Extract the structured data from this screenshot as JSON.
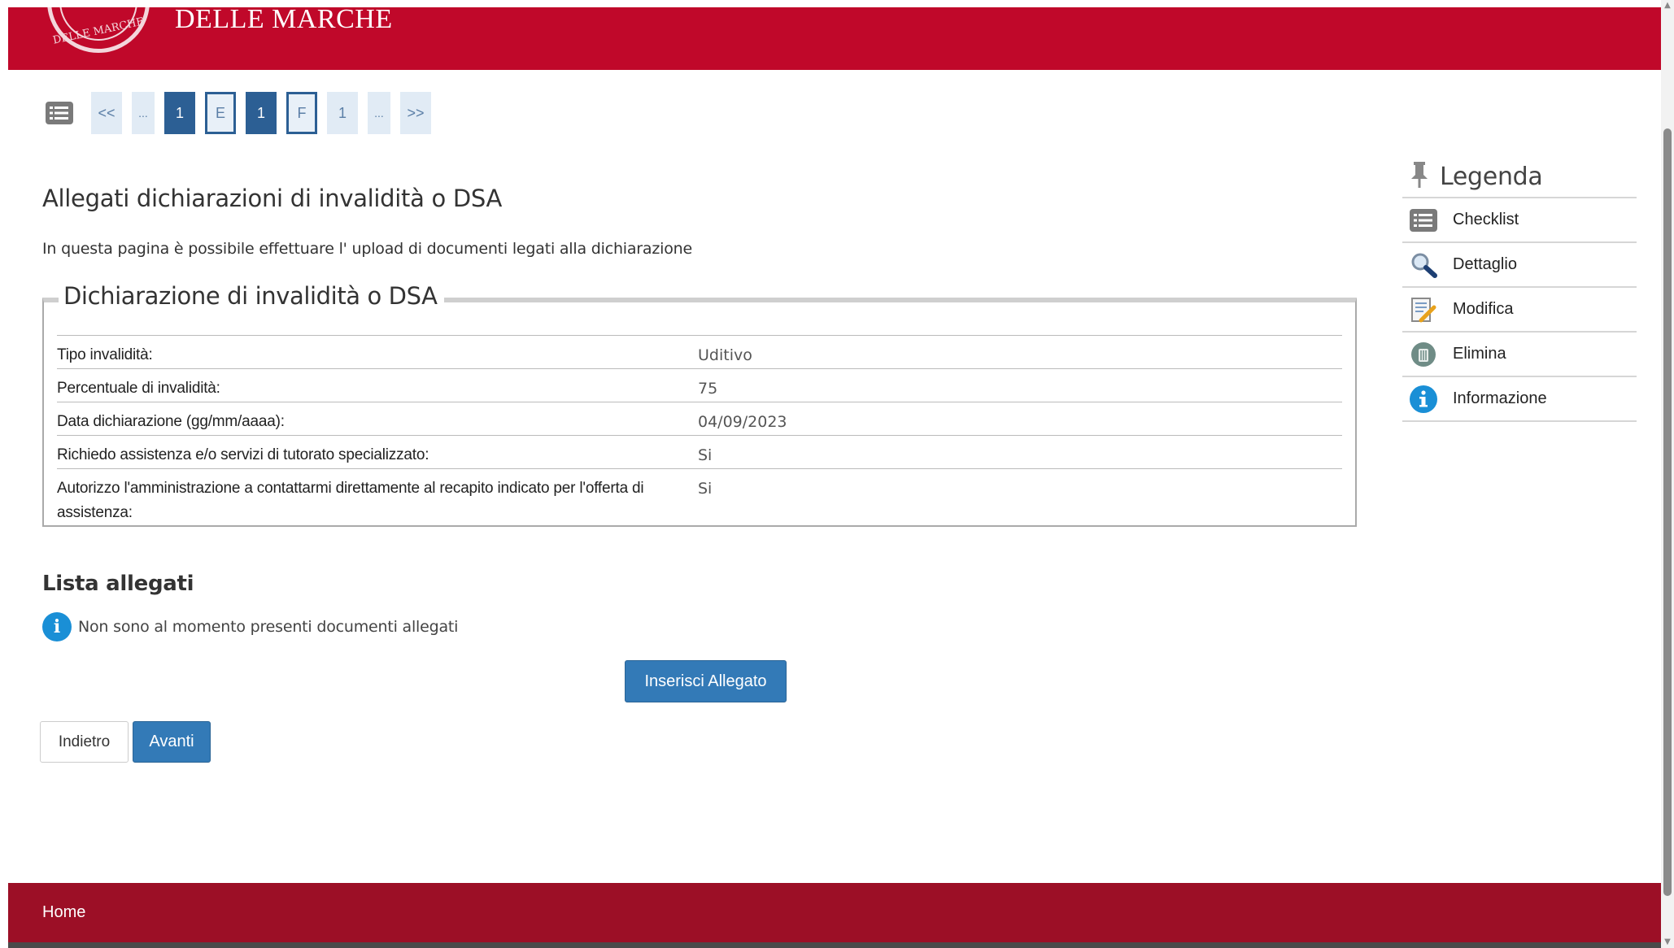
{
  "header": {
    "seal_text": "DELLE MARCHE",
    "title": "DELLE MARCHE"
  },
  "pagination": {
    "items": [
      {
        "label": "<<",
        "kind": "arrow"
      },
      {
        "label": "...",
        "kind": "dots"
      },
      {
        "label": "1",
        "kind": "num"
      },
      {
        "label": "E",
        "kind": "boxed"
      },
      {
        "label": "1",
        "kind": "active"
      },
      {
        "label": "F",
        "kind": "boxed"
      },
      {
        "label": "1",
        "kind": "num"
      },
      {
        "label": "...",
        "kind": "dots"
      },
      {
        "label": ">>",
        "kind": "arrow"
      }
    ]
  },
  "main": {
    "title": "Allegati dichiarazioni di invalidità o DSA",
    "intro": "In questa pagina è possibile effettuare l' upload di documenti legati alla dichiarazione",
    "fieldset_title": "Dichiarazione di invalidità o DSA",
    "rows": [
      {
        "label": "Tipo invalidità:",
        "value": "Uditivo"
      },
      {
        "label": "Percentuale di invalidità:",
        "value": "75"
      },
      {
        "label": "Data dichiarazione (gg/mm/aaaa):",
        "value": "04/09/2023"
      },
      {
        "label": "Richiedo assistenza e/o servizi di tutorato specializzato:",
        "value": "Si"
      },
      {
        "label": "Autorizzo l'amministrazione a contattarmi direttamente al recapito indicato per l'offerta di assistenza:",
        "value": "Si"
      }
    ],
    "attachments_title": "Lista allegati",
    "no_attachments": "Non sono al momento presenti documenti allegati",
    "insert_button": "Inserisci Allegato",
    "back_button": "Indietro",
    "next_button": "Avanti"
  },
  "legend": {
    "title": "Legenda",
    "items": [
      {
        "label": "Checklist",
        "icon": "checklist-icon"
      },
      {
        "label": "Dettaglio",
        "icon": "magnifier-icon"
      },
      {
        "label": "Modifica",
        "icon": "edit-icon"
      },
      {
        "label": "Elimina",
        "icon": "trash-icon"
      },
      {
        "label": "Informazione",
        "icon": "info-icon"
      }
    ]
  },
  "footer": {
    "home_link": "Home"
  },
  "colors": {
    "header_red": "#c0082a",
    "footer_red": "#9c0f26",
    "primary_blue": "#337ab7",
    "pager_active": "#2c5f94",
    "info_blue": "#1a8fd6"
  }
}
